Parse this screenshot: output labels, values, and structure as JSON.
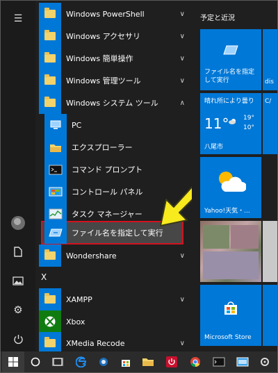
{
  "applist": {
    "items": [
      {
        "label": "Windows PowerShell",
        "chev": "∨"
      },
      {
        "label": "Windows アクセサリ",
        "chev": "∨"
      },
      {
        "label": "Windows 簡単操作",
        "chev": "∨"
      },
      {
        "label": "Windows 管理ツール",
        "chev": "∨"
      },
      {
        "label": "Windows システム ツール",
        "chev": "∧"
      },
      {
        "label": "PC"
      },
      {
        "label": "エクスプローラー"
      },
      {
        "label": "コマンド プロンプト"
      },
      {
        "label": "コントロール パネル"
      },
      {
        "label": "タスク マネージャー"
      },
      {
        "label": "ファイル名を指定して実行"
      },
      {
        "label": "Wondershare",
        "chev": "∨"
      },
      {
        "label": "XAMPP",
        "chev": "∨"
      },
      {
        "label": "Xbox"
      },
      {
        "label": "XMedia Recode",
        "chev": "∨"
      }
    ],
    "section_x": "X"
  },
  "tiles": {
    "title": "予定と近況",
    "run_tile": "ファイル名を指定して実行",
    "weather_header": "晴れ所により曇り",
    "weather_temp": "11°",
    "weather_hi": "19°",
    "weather_lo": "10°",
    "weather_city": "八尾市",
    "yahoo_tile": "Yahoo!天気・...",
    "store_tile": "Microsoft Store",
    "partial_dis": "dis",
    "partial_c": "C/"
  },
  "colors": {
    "accent": "#0078d7",
    "highlight_border": "#d4121f",
    "arrow": "#f7ea1d"
  },
  "icons": {
    "hamburger": "☰",
    "power": "⏻",
    "gear": "⚙"
  }
}
